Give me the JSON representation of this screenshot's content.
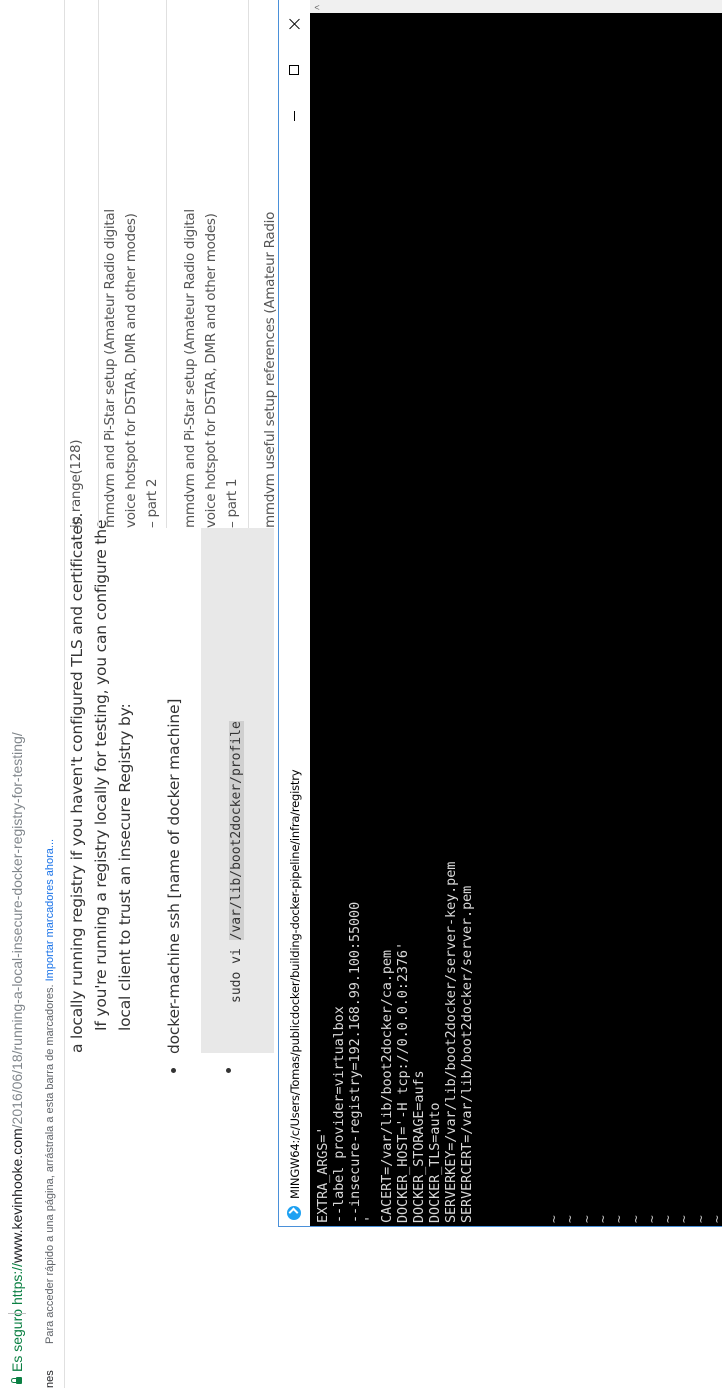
{
  "browser": {
    "secure_label": "Es seguro",
    "url_scheme": "https://",
    "url_host": "www.kevinhooke.com",
    "url_path": "/2016/06/18/running-a-local-insecure-docker-registry-for-testing/",
    "bookmarks_left_clip": "nes",
    "bookmarks_hint": "Para acceder rápido a una página, arrástrala a esta barra de marcadores.",
    "bookmarks_import_link": "Importar marcadores ahora..."
  },
  "article": {
    "para_line1": "a locally running registry if you haven't configured TLS and certificates.",
    "para_line2": "If you're running a registry locally for testing, you can configure the",
    "para_line3": "local client to trust an insecure Registry by:",
    "bullet1": "docker-machine ssh [name of docker machine]",
    "code_prefix": "sudo vi ",
    "code_path": "/var/lib/boot2docker/profile"
  },
  "sidebar": {
    "item0": "in range(128)",
    "item1_lines": [
      "mmdvm and Pi-Star setup (Amateur Radio digital",
      "voice hotspot for DSTAR, DMR and other modes)",
      "– part 2"
    ],
    "item2_lines": [
      "mmdvm and Pi-Star setup (Amateur Radio digital",
      "voice hotspot for DSTAR, DMR and other modes)",
      "– part 1"
    ],
    "item3_lines": [
      "mmdvm useful setup references (Amateur Radio"
    ]
  },
  "terminal": {
    "title": "MINGW64:/c/Users/Tomas/publicdocker/building-docker-pipeline/infra/registry",
    "lines": [
      "EXTRA_ARGS='",
      "--label provider=virtualbox",
      "--insecure-registry=192.168.99.100:55000",
      "'",
      "CACERT=/var/lib/boot2docker/ca.pem",
      "DOCKER_HOST='-H tcp://0.0.0.0:2376'",
      "DOCKER_STORAGE=aufs",
      "DOCKER_TLS=auto",
      "SERVERKEY=/var/lib/boot2docker/server-key.pem",
      "SERVERCERT=/var/lib/boot2docker/server.pem"
    ],
    "tilde": "~",
    "tilde_count": 11,
    "scroll_arrow": "<"
  },
  "colors": {
    "secure_green": "#0b8043",
    "link_blue": "#1a73e8",
    "terminal_bg": "#000000",
    "terminal_fg": "#d8d8d8",
    "mingw_icon": "#1ea1f2"
  }
}
